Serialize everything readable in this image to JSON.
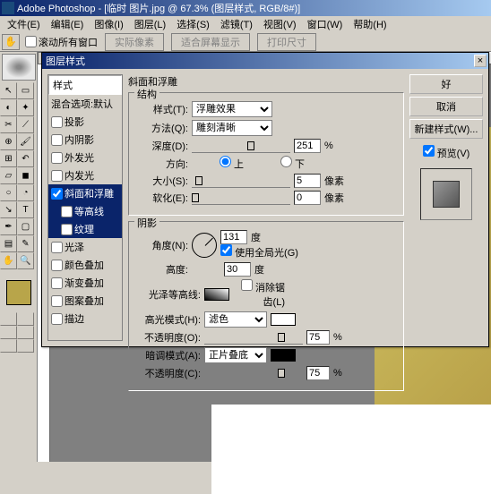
{
  "app": {
    "title": "Adobe Photoshop - [临时 图片.jpg @ 67.3% (图层样式, RGB/8#)]"
  },
  "menu": {
    "file": "文件(E)",
    "edit": "编辑(E)",
    "image": "图像(I)",
    "layer": "图层(L)",
    "select": "选择(S)",
    "filter": "滤镜(T)",
    "view": "视图(V)",
    "window": "窗口(W)",
    "help": "帮助(H)"
  },
  "opt": {
    "scroll_all": "滚动所有窗口",
    "btn1": "实际像素",
    "btn2": "适合屏幕显示",
    "btn3": "打印尺寸"
  },
  "dialog": {
    "title": "图层样式",
    "styles_hdr": "样式",
    "blend_opts": "混合选项:默认",
    "list": {
      "drop_shadow": "投影",
      "inner_shadow": "内阴影",
      "outer_glow": "外发光",
      "inner_glow": "内发光",
      "bevel": "斜面和浮雕",
      "contour": "等高线",
      "texture": "纹理",
      "satin": "光泽",
      "color_overlay": "颜色叠加",
      "grad_overlay": "渐变叠加",
      "pattern_overlay": "图案叠加",
      "stroke": "描边"
    },
    "bevel": {
      "title": "斜面和浮雕",
      "structure": "结构",
      "style_lbl": "样式(T):",
      "style_val": "浮雕效果",
      "technique_lbl": "方法(Q):",
      "technique_val": "雕刻清晰",
      "depth_lbl": "深度(D):",
      "depth_val": "251",
      "pct": "%",
      "direction_lbl": "方向:",
      "up": "上",
      "down": "下",
      "size_lbl": "大小(S):",
      "size_val": "5",
      "px": "像素",
      "soften_lbl": "软化(E):",
      "soften_val": "0",
      "shading": "阴影",
      "angle_lbl": "角度(N):",
      "angle_val": "131",
      "deg": "度",
      "global_light": "使用全局光(G)",
      "altitude_lbl": "高度:",
      "altitude_val": "30",
      "gloss_lbl": "光泽等高线:",
      "antialias": "消除锯齿(L)",
      "highlight_mode_lbl": "高光模式(H):",
      "highlight_mode_val": "滤色",
      "opacity_lbl": "不透明度(O):",
      "opacity_val": "75",
      "shadow_mode_lbl": "暗调模式(A):",
      "shadow_mode_val": "正片叠底",
      "opacity2_lbl": "不透明度(C):",
      "opacity2_val": "75"
    },
    "buttons": {
      "ok": "好",
      "cancel": "取消",
      "new_style": "新建样式(W)...",
      "preview": "预览(V)"
    }
  }
}
